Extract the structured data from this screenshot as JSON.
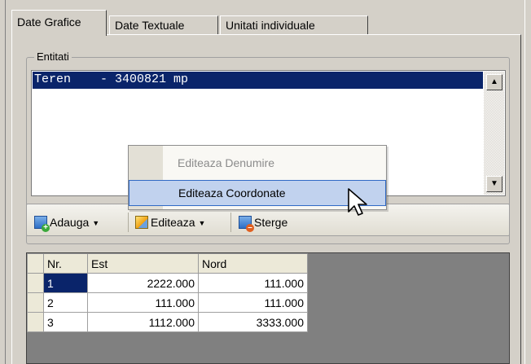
{
  "tabs": [
    {
      "label": "Date Grafice",
      "active": true
    },
    {
      "label": "Date Textuale",
      "active": false
    },
    {
      "label": "Unitati individuale",
      "active": false
    }
  ],
  "entities_group": {
    "title": "Entitati",
    "items": [
      "Teren    - 3400821 mp"
    ]
  },
  "toolbar": {
    "add_label": "Adauga",
    "edit_label": "Editeaza",
    "delete_label": "Sterge"
  },
  "context_menu": {
    "items": [
      {
        "label": "Editeaza Denumire",
        "enabled": false
      },
      {
        "label": "Editeaza Coordonate",
        "enabled": true,
        "highlighted": true
      }
    ]
  },
  "grid": {
    "columns": [
      "Nr.",
      "Est",
      "Nord"
    ],
    "rows": [
      {
        "nr": "1",
        "est": "2222.000",
        "nord": "111.000",
        "selected": true
      },
      {
        "nr": "2",
        "est": "111.000",
        "nord": "111.000",
        "selected": false
      },
      {
        "nr": "3",
        "est": "1112.000",
        "nord": "3333.000",
        "selected": false
      }
    ]
  },
  "icons": {
    "scroll_up": "scroll-up-arrow-icon",
    "scroll_down": "scroll-down-arrow-icon",
    "add": "add-document-icon",
    "edit": "pencil-edit-icon",
    "delete": "delete-document-icon",
    "dropdown": "chevron-down-icon",
    "cursor": "mouse-pointer-icon"
  },
  "colors": {
    "selection": "#0a246a",
    "menu_highlight": "#c1d2ee",
    "grid_background": "#808080"
  }
}
